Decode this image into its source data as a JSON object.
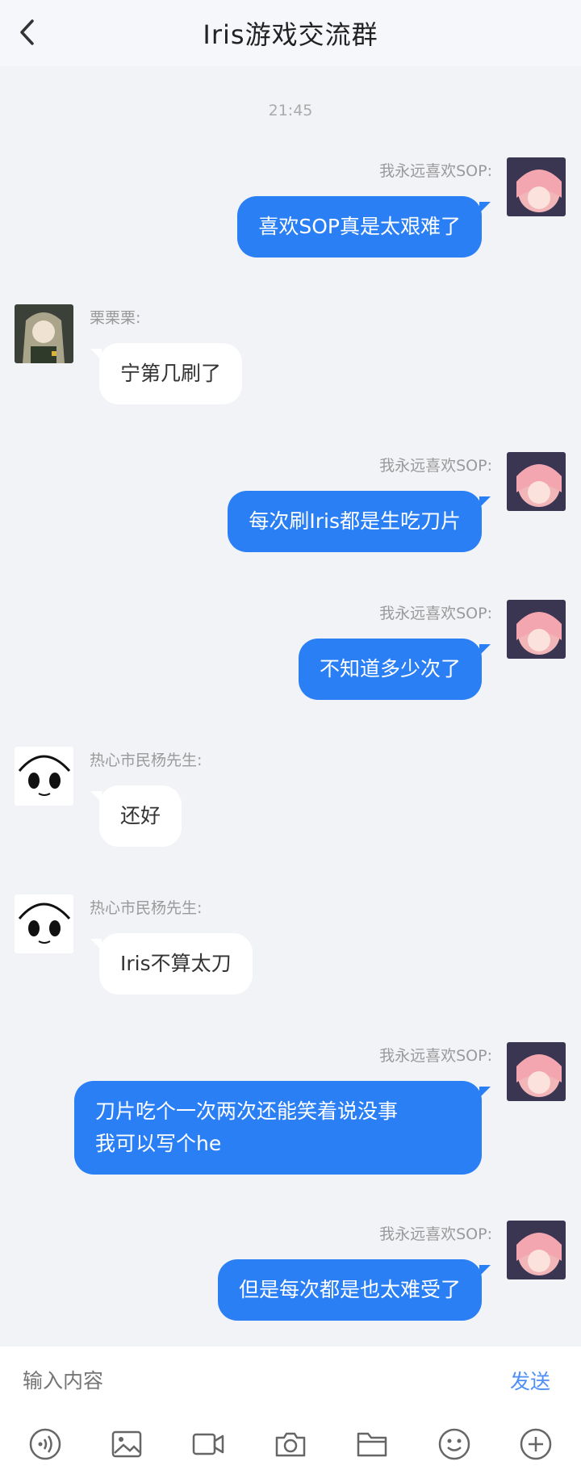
{
  "header": {
    "title": "Iris游戏交流群"
  },
  "timestamp": "21:45",
  "messages": [
    {
      "side": "out",
      "name": "我永远喜欢SOP:",
      "text": "喜欢SOP真是太艰难了"
    },
    {
      "side": "in",
      "name": "栗栗栗:",
      "text": "宁第几刷了"
    },
    {
      "side": "out",
      "name": "我永远喜欢SOP:",
      "text": "每次刷Iris都是生吃刀片"
    },
    {
      "side": "out",
      "name": "我永远喜欢SOP:",
      "text": "不知道多少次了"
    },
    {
      "side": "in",
      "name": "热心市民杨先生:",
      "text": "还好"
    },
    {
      "side": "in",
      "name": "热心市民杨先生:",
      "text": "Iris不算太刀"
    },
    {
      "side": "out",
      "name": "我永远喜欢SOP:",
      "text": "刀片吃个一次两次还能笑着说没事\n我可以写个he"
    },
    {
      "side": "out",
      "name": "我永远喜欢SOP:",
      "text": "但是每次都是也太难受了"
    }
  ],
  "input": {
    "placeholder": "输入内容",
    "send_label": "发送"
  },
  "toolbar": [
    "voice-icon",
    "image-icon",
    "video-icon",
    "camera-icon",
    "folder-icon",
    "emoji-icon",
    "add-icon"
  ],
  "colors": {
    "accent": "#2b7ff5",
    "send": "#4d8ef7",
    "background": "#f2f3f7"
  }
}
